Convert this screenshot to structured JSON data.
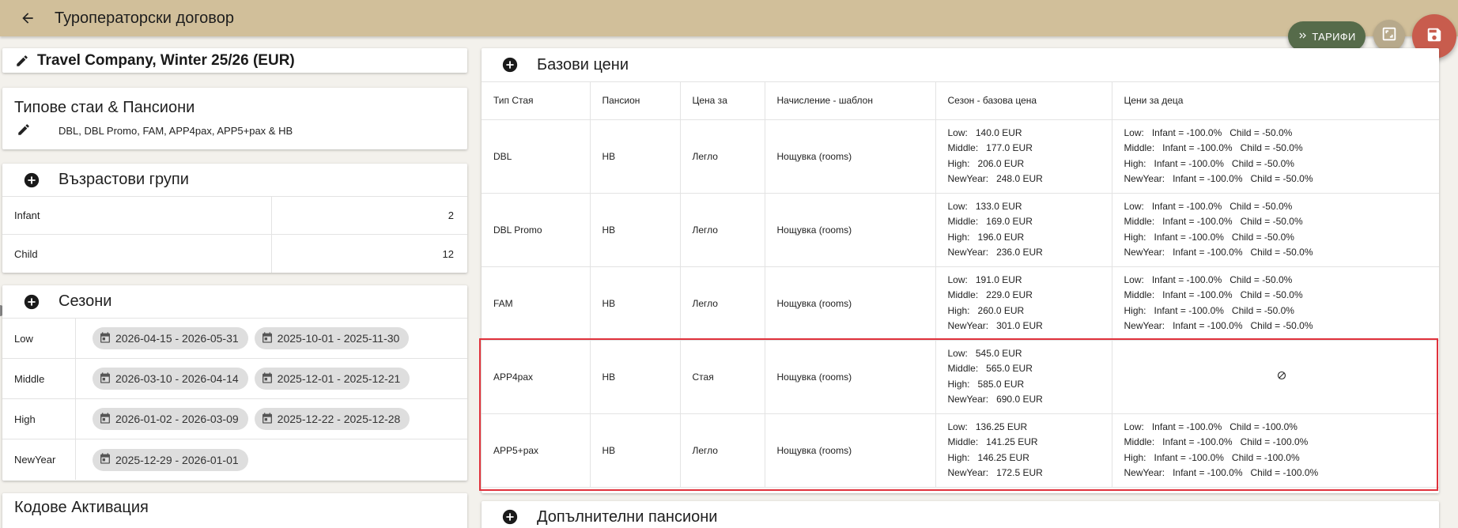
{
  "header": {
    "title": "Туроператорски договор"
  },
  "fabs": {
    "tarifi_label": "ТАРИФИ"
  },
  "contract": {
    "name": "Travel Company, Winter 25/26 (EUR)"
  },
  "rooms": {
    "title": "Типове стаи & Пансиони",
    "list": "DBL, DBL Promo, FAM, APP4pax, APP5+pax & HB"
  },
  "age_groups": {
    "title": "Възрастови групи",
    "rows": [
      {
        "label": "Infant",
        "value": "2"
      },
      {
        "label": "Child",
        "value": "12"
      }
    ]
  },
  "seasons": {
    "title": "Сезони",
    "rows": [
      {
        "label": "Low",
        "chips": [
          "2026-04-15 - 2026-05-31",
          "2025-10-01 - 2025-11-30"
        ]
      },
      {
        "label": "Middle",
        "chips": [
          "2026-03-10 - 2026-04-14",
          "2025-12-01 - 2025-12-21"
        ]
      },
      {
        "label": "High",
        "chips": [
          "2026-01-02 - 2026-03-09",
          "2025-12-22 - 2025-12-28"
        ]
      },
      {
        "label": "NewYear",
        "chips": [
          "2025-12-29 - 2026-01-01"
        ]
      }
    ]
  },
  "codes": {
    "title": "Кодове Активация"
  },
  "base_prices": {
    "title": "Базови цени",
    "headers": [
      "Тип Стая",
      "Пансион",
      "Цена за",
      "Начисление - шаблон",
      "Сезон - базова цена",
      "Цени за деца"
    ],
    "rows": [
      {
        "room": "DBL",
        "board": "HB",
        "price_for": "Легло",
        "template": "Нощувка (rooms)",
        "season_prices": [
          "Low:   140.0 EUR",
          "Middle:   177.0 EUR",
          "High:   206.0 EUR",
          "NewYear:   248.0 EUR"
        ],
        "child_prices": [
          "Low:   Infant = -100.0%   Child = -50.0%",
          "Middle:   Infant = -100.0%   Child = -50.0%",
          "High:   Infant = -100.0%   Child = -50.0%",
          "NewYear:   Infant = -100.0%   Child = -50.0%"
        ]
      },
      {
        "room": "DBL Promo",
        "board": "HB",
        "price_for": "Легло",
        "template": "Нощувка (rooms)",
        "season_prices": [
          "Low:   133.0 EUR",
          "Middle:   169.0 EUR",
          "High:   196.0 EUR",
          "NewYear:   236.0 EUR"
        ],
        "child_prices": [
          "Low:   Infant = -100.0%   Child = -50.0%",
          "Middle:   Infant = -100.0%   Child = -50.0%",
          "High:   Infant = -100.0%   Child = -50.0%",
          "NewYear:   Infant = -100.0%   Child = -50.0%"
        ]
      },
      {
        "room": "FAM",
        "board": "HB",
        "price_for": "Легло",
        "template": "Нощувка (rooms)",
        "season_prices": [
          "Low:   191.0 EUR",
          "Middle:   229.0 EUR",
          "High:   260.0 EUR",
          "NewYear:   301.0 EUR"
        ],
        "child_prices": [
          "Low:   Infant = -100.0%   Child = -50.0%",
          "Middle:   Infant = -100.0%   Child = -50.0%",
          "High:   Infant = -100.0%   Child = -50.0%",
          "NewYear:   Infant = -100.0%   Child = -50.0%"
        ]
      },
      {
        "room": "APP4pax",
        "board": "HB",
        "price_for": "Стая",
        "template": "Нощувка (rooms)",
        "season_prices": [
          "Low:   545.0 EUR",
          "Middle:   565.0 EUR",
          "High:   585.0 EUR",
          "NewYear:   690.0 EUR"
        ],
        "child_prices": [],
        "child_none": true
      },
      {
        "room": "APP5+pax",
        "board": "HB",
        "price_for": "Легло",
        "template": "Нощувка (rooms)",
        "season_prices": [
          "Low:   136.25 EUR",
          "Middle:   141.25 EUR",
          "High:   146.25 EUR",
          "NewYear:   172.5 EUR"
        ],
        "child_prices": [
          "Low:   Infant = -100.0%   Child = -100.0%",
          "Middle:   Infant = -100.0%   Child = -100.0%",
          "High:   Infant = -100.0%   Child = -100.0%",
          "NewYear:   Infant = -100.0%   Child = -100.0%"
        ]
      }
    ]
  },
  "extra_boards": {
    "title": "Допълнителни пансиони"
  }
}
